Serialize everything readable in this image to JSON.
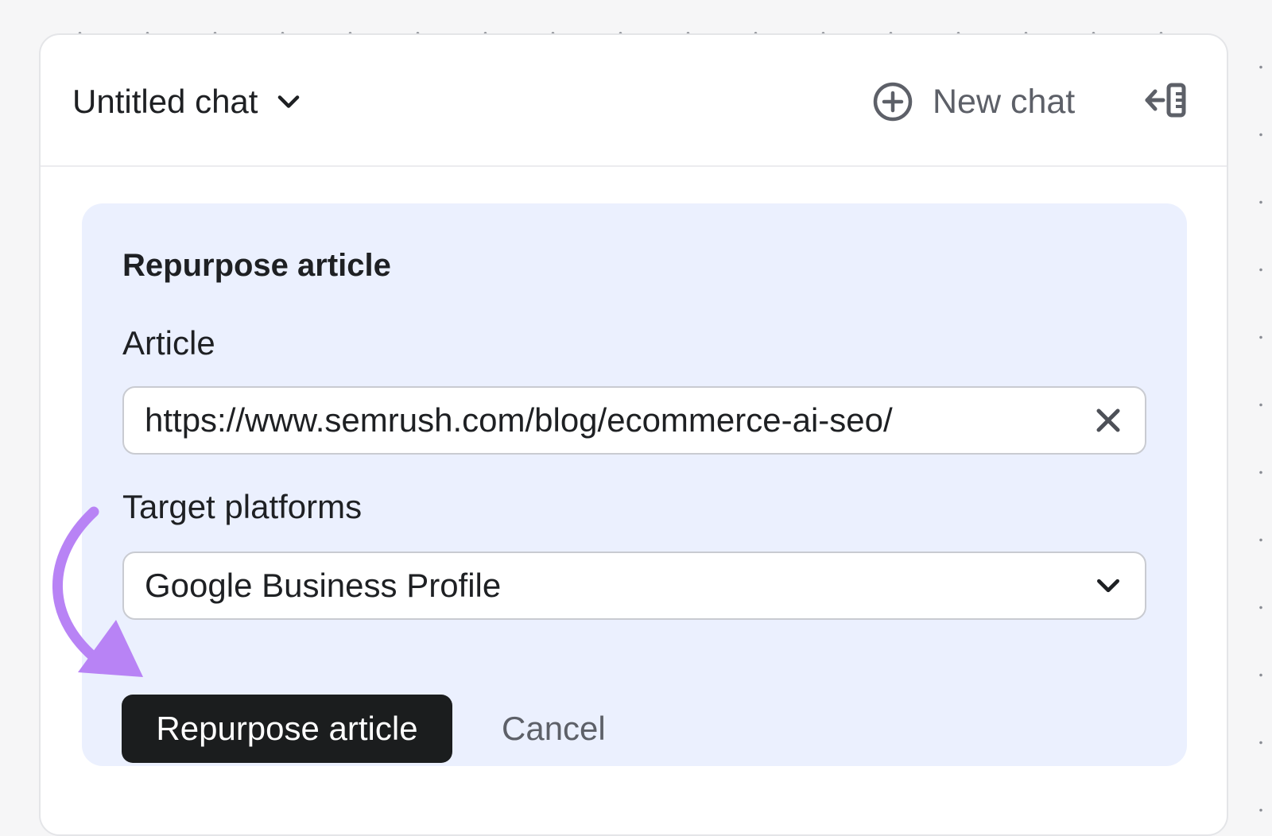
{
  "header": {
    "chat_title": "Untitled chat",
    "new_chat_label": "New chat"
  },
  "form": {
    "title": "Repurpose article",
    "article_label": "Article",
    "article_value": "https://www.semrush.com/blog/ecommerce-ai-seo/",
    "platforms_label": "Target platforms",
    "platforms_value": "Google Business Profile",
    "submit_label": "Repurpose article",
    "cancel_label": "Cancel"
  },
  "icons": {
    "title_dropdown": "chevron-down-icon",
    "new_chat": "plus-circle-icon",
    "collapse_panel": "collapse-panel-icon",
    "clear_field": "close-icon",
    "select_dropdown": "chevron-down-icon"
  },
  "colors": {
    "card_background": "#ebf0fe",
    "primary_button": "#1b1d1e",
    "annotation_arrow": "#b883f5"
  }
}
